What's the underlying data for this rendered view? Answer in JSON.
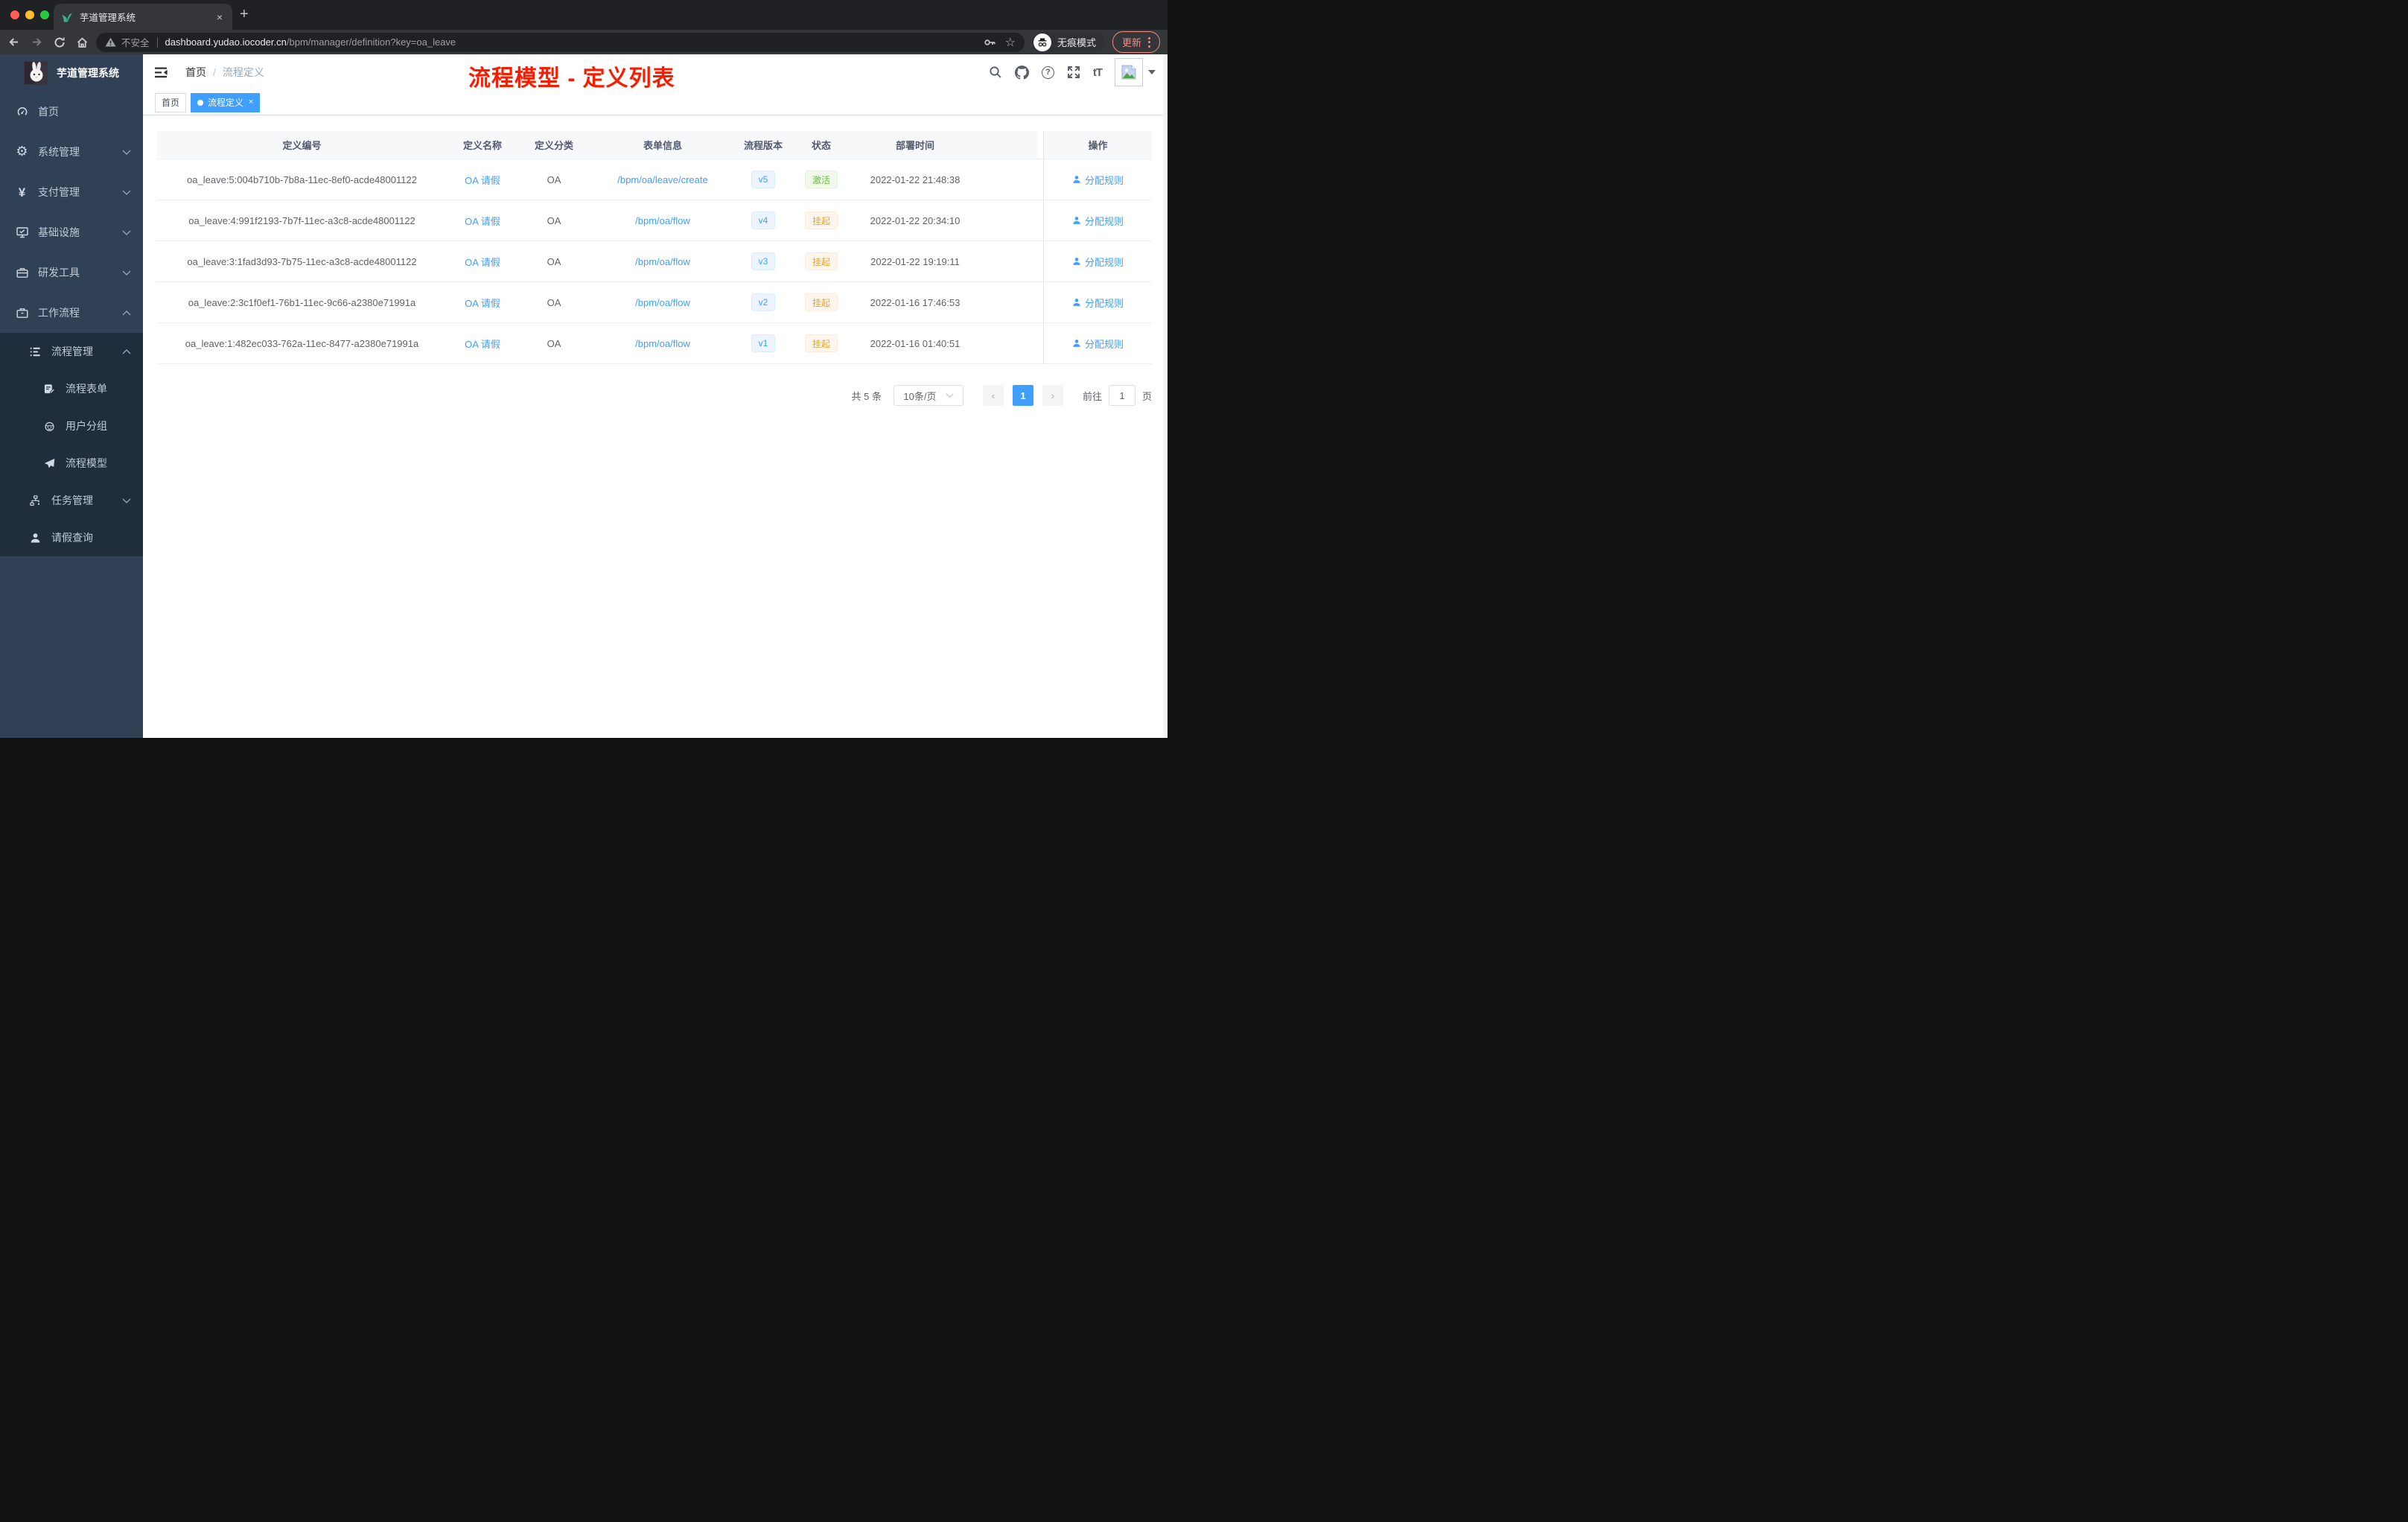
{
  "browser": {
    "tab_title": "芋道管理系统",
    "tab_close": "×",
    "new_tab": "+",
    "security_label": "不安全",
    "url_host": "dashboard.yudao.iocoder.cn",
    "url_path": "/bpm/manager/definition?key=oa_leave",
    "incognito_label": "无痕模式",
    "update_label": "更新"
  },
  "icons": {
    "star": "☆",
    "gear": "⚙",
    "yen": "¥",
    "question": "?",
    "font_size": "tT"
  },
  "sidebar": {
    "app_title": "芋道管理系统",
    "menu": [
      {
        "label": "首页"
      },
      {
        "label": "系统管理"
      },
      {
        "label": "支付管理"
      },
      {
        "label": "基础设施"
      },
      {
        "label": "研发工具"
      },
      {
        "label": "工作流程"
      },
      {
        "label": "流程管理"
      },
      {
        "label": "流程表单"
      },
      {
        "label": "用户分组"
      },
      {
        "label": "流程模型"
      },
      {
        "label": "任务管理"
      },
      {
        "label": "请假查询"
      }
    ]
  },
  "header": {
    "breadcrumb_home": "首页",
    "breadcrumb_sep": "/",
    "breadcrumb_current": "流程定义",
    "annotation": "流程模型 - 定义列表"
  },
  "tags": {
    "home": "首页",
    "active": "流程定义",
    "close": "×"
  },
  "table": {
    "headers": [
      "定义编号",
      "定义名称",
      "定义分类",
      "表单信息",
      "流程版本",
      "状态",
      "部署时间",
      "操作"
    ],
    "action_label": "分配规则",
    "rows": [
      {
        "id": "oa_leave:5:004b710b-7b8a-11ec-8ef0-acde48001122",
        "name": "OA 请假",
        "category": "OA",
        "form": "/bpm/oa/leave/create",
        "version": "v5",
        "status": "激活",
        "status_type": "active",
        "time": "2022-01-22 21:48:38"
      },
      {
        "id": "oa_leave:4:991f2193-7b7f-11ec-a3c8-acde48001122",
        "name": "OA 请假",
        "category": "OA",
        "form": "/bpm/oa/flow",
        "version": "v4",
        "status": "挂起",
        "status_type": "suspended",
        "time": "2022-01-22 20:34:10"
      },
      {
        "id": "oa_leave:3:1fad3d93-7b75-11ec-a3c8-acde48001122",
        "name": "OA 请假",
        "category": "OA",
        "form": "/bpm/oa/flow",
        "version": "v3",
        "status": "挂起",
        "status_type": "suspended",
        "time": "2022-01-22 19:19:11"
      },
      {
        "id": "oa_leave:2:3c1f0ef1-76b1-11ec-9c66-a2380e71991a",
        "name": "OA 请假",
        "category": "OA",
        "form": "/bpm/oa/flow",
        "version": "v2",
        "status": "挂起",
        "status_type": "suspended",
        "time": "2022-01-16 17:46:53"
      },
      {
        "id": "oa_leave:1:482ec033-762a-11ec-8477-a2380e71991a",
        "name": "OA 请假",
        "category": "OA",
        "form": "/bpm/oa/flow",
        "version": "v1",
        "status": "挂起",
        "status_type": "suspended",
        "time": "2022-01-16 01:40:51"
      }
    ]
  },
  "pagination": {
    "total": "共 5 条",
    "page_size": "10条/页",
    "prev": "‹",
    "next": "›",
    "page": "1",
    "goto_label": "前往",
    "page_unit": "页"
  },
  "colors": {
    "accent": "#409eff",
    "status_active": "#67c23a",
    "status_suspended": "#e6a23c",
    "annotation_red": "#f81c00",
    "sidebar_bg": "#304156",
    "submenu_bg": "#1f2d3d"
  }
}
